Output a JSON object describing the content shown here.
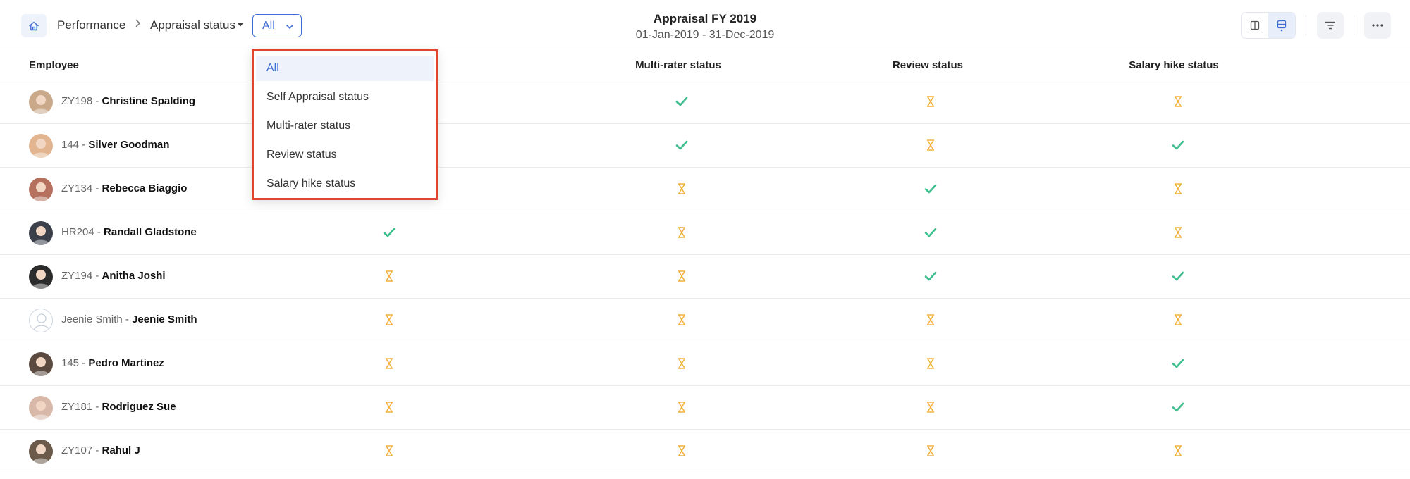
{
  "header": {
    "breadcrumb": [
      "Performance",
      "Appraisal status"
    ],
    "filter_value": "All",
    "title": "Appraisal FY 2019",
    "date_range": "01-Jan-2019 - 31-Dec-2019"
  },
  "table": {
    "columns": [
      "Employee",
      "Multi-rater status",
      "Review status",
      "Salary hike status"
    ],
    "rows": [
      {
        "code": "ZY198",
        "name": "Christine Spalding",
        "self": null,
        "multi": "done",
        "review": "pending",
        "salary": "pending"
      },
      {
        "code": "144",
        "name": "Silver Goodman",
        "self": null,
        "multi": "done",
        "review": "pending",
        "salary": "done"
      },
      {
        "code": "ZY134",
        "name": "Rebecca Biaggio",
        "self": null,
        "multi": "pending",
        "review": "done",
        "salary": "pending"
      },
      {
        "code": "HR204",
        "name": "Randall Gladstone",
        "self": "done",
        "multi": "pending",
        "review": "done",
        "salary": "pending"
      },
      {
        "code": "ZY194",
        "name": "Anitha Joshi",
        "self": "pending",
        "multi": "pending",
        "review": "done",
        "salary": "done"
      },
      {
        "code": "Jeenie Smith",
        "name": "Jeenie Smith",
        "self": "pending",
        "multi": "pending",
        "review": "pending",
        "salary": "pending"
      },
      {
        "code": "145",
        "name": "Pedro Martinez",
        "self": "pending",
        "multi": "pending",
        "review": "pending",
        "salary": "done"
      },
      {
        "code": "ZY181",
        "name": "Rodriguez Sue",
        "self": "pending",
        "multi": "pending",
        "review": "pending",
        "salary": "done"
      },
      {
        "code": "ZY107",
        "name": "Rahul J",
        "self": "pending",
        "multi": "pending",
        "review": "pending",
        "salary": "pending"
      }
    ]
  },
  "dropdown": {
    "items": [
      "All",
      "Self Appraisal status",
      "Multi-rater status",
      "Review status",
      "Salary hike status"
    ],
    "selected": "All"
  },
  "colors": {
    "accent": "#3f6dd8",
    "done": "#3ebf8e",
    "pending": "#f2b23e",
    "highlight_border": "#e0452f"
  }
}
